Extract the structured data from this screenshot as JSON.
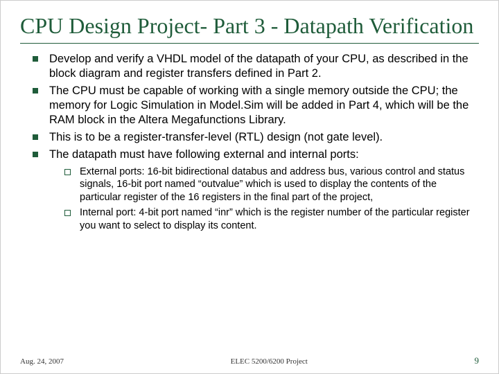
{
  "title": "CPU Design Project- Part 3 - Datapath Verification",
  "bullets": [
    "Develop and verify a VHDL model of the datapath of your CPU, as described in the block diagram and register transfers defined in Part 2.",
    "The CPU must be capable of working with a single memory outside the CPU; the memory for Logic Simulation in Model.Sim will be added in Part 4, which will be the RAM block in the Altera Megafunctions Library.",
    "This is to be a register-transfer-level (RTL) design (not gate level).",
    "The datapath must have following external and internal ports:"
  ],
  "subBullets": [
    "External ports: 16-bit bidirectional databus and address bus, various control and status signals, 16-bit port named “outvalue” which is used to display the contents of the particular register of the 16 registers in the final part of the project,",
    "Internal port: 4-bit port named “inr” which is the register number of the particular register you want to select to display its content."
  ],
  "footer": {
    "date": "Aug. 24, 2007",
    "center": "ELEC 5200/6200 Project",
    "page": "9"
  }
}
